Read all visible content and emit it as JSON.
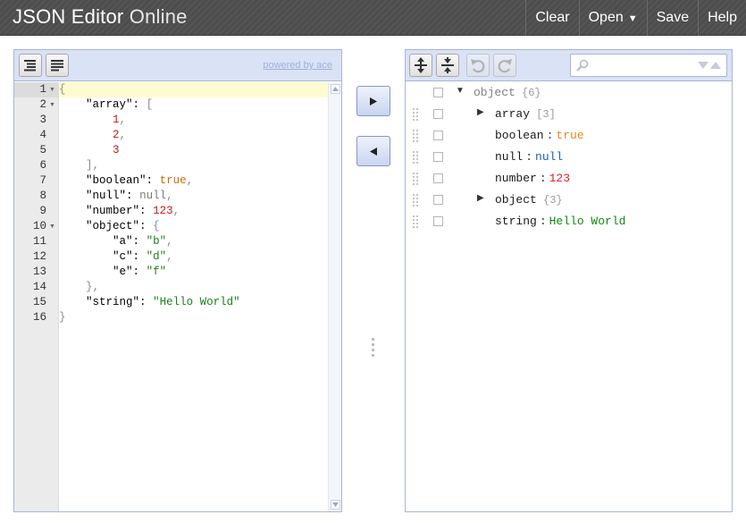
{
  "header": {
    "title_main": "JSON Editor",
    "title_light": "Online",
    "menu": {
      "clear": "Clear",
      "open": "Open",
      "save": "Save",
      "help": "Help"
    }
  },
  "left_panel": {
    "powered_by": "powered by ace",
    "icons": {
      "format": "format-icon",
      "compact": "compact-icon"
    },
    "line_numbers": [
      "1",
      "2",
      "3",
      "4",
      "5",
      "6",
      "7",
      "8",
      "9",
      "10",
      "11",
      "12",
      "13",
      "14",
      "15",
      "16"
    ],
    "code_lines": [
      "{",
      "    \"array\": [",
      "        1,",
      "        2,",
      "        3",
      "    ],",
      "    \"boolean\": true,",
      "    \"null\": null,",
      "    \"number\": 123,",
      "    \"object\": {",
      "        \"a\": \"b\",",
      "        \"c\": \"d\",",
      "        \"e\": \"f\"",
      "    },",
      "    \"string\": \"Hello World\"",
      "}"
    ]
  },
  "middle": {
    "to_tree_icon": "arrow-right-icon",
    "to_code_icon": "arrow-left-icon"
  },
  "right_panel": {
    "icons": {
      "expand_all": "expand-all-icon",
      "collapse_all": "collapse-all-icon",
      "undo": "undo-icon",
      "redo": "redo-icon",
      "search": "search-icon"
    },
    "search_placeholder": "",
    "tree": {
      "root": {
        "field": "object",
        "count": "{6}"
      },
      "rows": [
        {
          "field": "array",
          "count": "[3]",
          "sep": "",
          "value": ""
        },
        {
          "field": "boolean",
          "count": "",
          "sep": ":",
          "value": "true"
        },
        {
          "field": "null",
          "count": "",
          "sep": ":",
          "value": "null"
        },
        {
          "field": "number",
          "count": "",
          "sep": ":",
          "value": "123"
        },
        {
          "field": "object",
          "count": "{3}",
          "sep": "",
          "value": ""
        },
        {
          "field": "string",
          "count": "",
          "sep": ":",
          "value": "Hello World"
        }
      ]
    }
  },
  "colors": {
    "header_bg": "#4d4d4d",
    "toolbar_bg": "#dae2f6",
    "panel_border": "#a8b6d6",
    "bool": "#e08a1e",
    "null": "#1f5fbf",
    "number": "#d22222",
    "string": "#0e8a0e"
  }
}
